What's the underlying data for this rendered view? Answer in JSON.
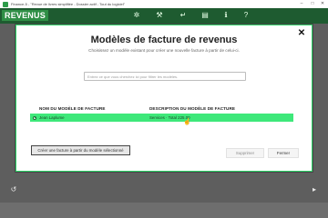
{
  "window": {
    "title": "Finance-5 - \"Revue de livres simplifiée - Dossier actif - Tout du logiciel\"",
    "minimize_label": "–",
    "maximize_label": "□",
    "close_label": "✕"
  },
  "appbar": {
    "brand": "REVENUS",
    "icons": [
      "gear-icon",
      "tools-icon",
      "back-icon",
      "chart-icon",
      "info-icon",
      "help-icon"
    ],
    "glyphs": [
      "✲",
      "⚒",
      "↵",
      "▤",
      "ℹ",
      "?"
    ]
  },
  "backdrop": {
    "undo_glyph": "↺",
    "nav_glyph": "▸"
  },
  "modal": {
    "title": "Modèles de facture de revenus",
    "subtitle": "Choisissez un modèle existant pour créer une nouvelle facture à partir de celui-ci.",
    "close_glyph": "✕",
    "search_placeholder": "Entrez ce que vous cherchez ici pour filtrer les modèles.",
    "search_value": "",
    "columns": {
      "name": "NOM DU MODÈLE DE FACTURE",
      "description": "DESCRIPTION DU MODÈLE DE FACTURE"
    },
    "rows": [
      {
        "name": "Jean Laplume",
        "description": "Services · Total 225.00",
        "selected": true
      }
    ],
    "buttons": {
      "create": "Créer une facture à partir du modèle sélectionné",
      "delete": "Supprimer",
      "close": "Fermer"
    }
  },
  "colors": {
    "accent": "#2bd466",
    "selected_row": "#3ee87a",
    "appbar": "#1e5b30",
    "brand": "#2f8f46"
  }
}
